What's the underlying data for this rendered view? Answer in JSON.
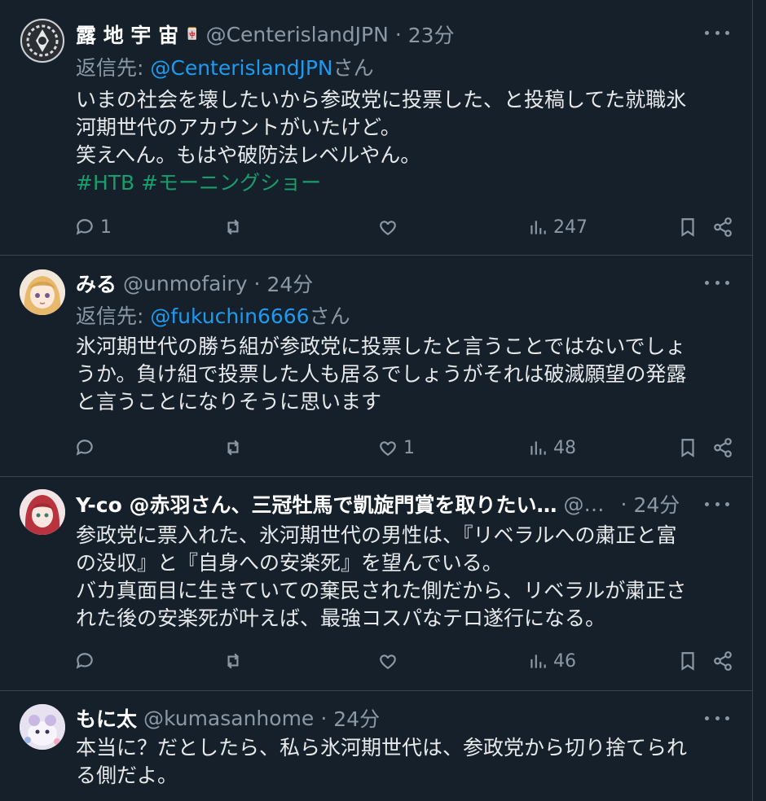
{
  "tweets": [
    {
      "name": "露 地 宇 宙",
      "emoji": "🀄",
      "handle": "@CenterislandJPN",
      "time": "23分",
      "reply_prefix": "返信先: ",
      "reply_to": "@CenterislandJPN",
      "reply_suffix": "さん",
      "body_lines": [
        "いまの社会を壊したいから参政党に投票した、と投稿してた就職氷",
        "河期世代のアカウントがいたけど。",
        "笑えへん。もはや破防法レベルやん。"
      ],
      "hashtags": "#HTB #モーニングショー",
      "replies": "1",
      "likes": "",
      "views": "247"
    },
    {
      "name": "みる",
      "handle": "@unmofairy",
      "time": "24分",
      "reply_prefix": "返信先: ",
      "reply_to": "@fukuchin6666",
      "reply_suffix": "さん",
      "body_lines": [
        "氷河期世代の勝ち組が参政党に投票したと言うことではないでしょ",
        "うか。負け組で投票した人も居るでしょうがそれは破滅願望の発露",
        "と言うことになりそうに思います"
      ],
      "replies": "",
      "likes": "1",
      "views": "48"
    },
    {
      "name": "Y-co @赤羽さん、三冠牡馬で凱旋門賞を取りたい…",
      "handle": "@0…",
      "time": "24分",
      "body_lines": [
        "参政党に票入れた、氷河期世代の男性は、『リベラルへの粛正と富",
        "の没収』と『自身への安楽死』を望んでいる。",
        "バカ真面目に生きていての棄民された側だから、リベラルが粛正さ",
        "れた後の安楽死が叶えば、最強コスパなテロ遂行になる。"
      ],
      "replies": "",
      "likes": "",
      "views": "46"
    },
    {
      "name": "もに太",
      "handle": "@kumasanhome",
      "time": "24分",
      "body_lines": [
        "本当に？だとしたら、私ら氷河期世代は、参政党から切り捨てられ",
        "る側だよ。"
      ]
    }
  ],
  "separator": "·",
  "colors": {
    "background": "#15202b",
    "border": "#38444d",
    "muted": "#8b98a5",
    "link": "#1d9bf0",
    "hashtag": "#1a9c6b"
  },
  "icons": [
    "more-icon",
    "reply-icon",
    "retweet-icon",
    "like-icon",
    "views-icon",
    "bookmark-icon",
    "share-icon"
  ]
}
